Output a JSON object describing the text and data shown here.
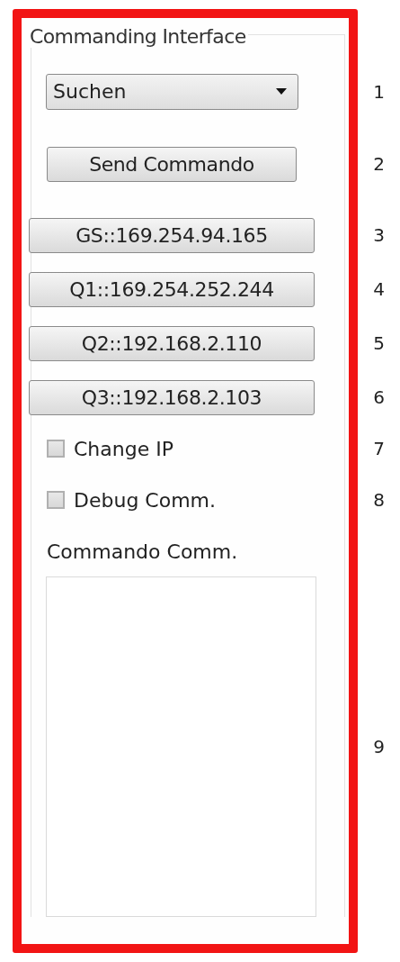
{
  "group_title": "Commanding Interface",
  "command_select": {
    "value": "Suchen"
  },
  "send_button": "Send Commando",
  "host_buttons": [
    "GS::169.254.94.165",
    "Q1::169.254.252.244",
    "Q2::192.168.2.110",
    "Q3::192.168.2.103"
  ],
  "checkboxes": [
    {
      "label": "Change IP",
      "checked": false
    },
    {
      "label": "Debug Comm.",
      "checked": false
    }
  ],
  "log": {
    "label": "Commando Comm."
  },
  "markers": [
    "1",
    "2",
    "3",
    "4",
    "5",
    "6",
    "7",
    "8",
    "9"
  ]
}
